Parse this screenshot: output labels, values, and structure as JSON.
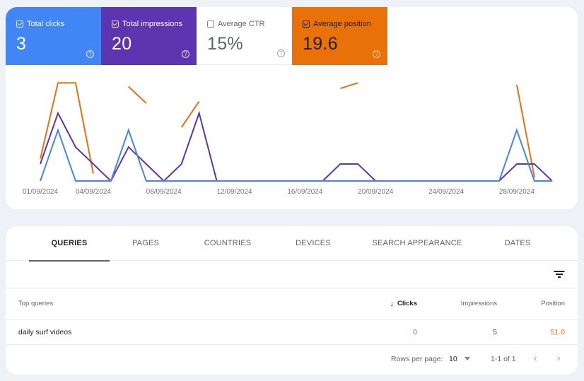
{
  "metrics": [
    {
      "key": "clicks",
      "label": "Total clicks",
      "value": "3",
      "checked": true,
      "color": "#4285f4"
    },
    {
      "key": "impressions",
      "label": "Total impressions",
      "value": "20",
      "checked": true,
      "color": "#5e35b1"
    },
    {
      "key": "ctr",
      "label": "Average CTR",
      "value": "15%",
      "checked": false,
      "color": "#00897b"
    },
    {
      "key": "position",
      "label": "Average position",
      "value": "19.6",
      "checked": true,
      "color": "#e8710a"
    }
  ],
  "help_glyph": "?",
  "chart_data": {
    "type": "line",
    "title": "",
    "xlabel": "",
    "ylabel": "",
    "x": [
      "01/09/2024",
      "02/09/2024",
      "03/09/2024",
      "04/09/2024",
      "05/09/2024",
      "06/09/2024",
      "07/09/2024",
      "08/09/2024",
      "09/09/2024",
      "10/09/2024",
      "11/09/2024",
      "12/09/2024",
      "13/09/2024",
      "14/09/2024",
      "15/09/2024",
      "16/09/2024",
      "17/09/2024",
      "18/09/2024",
      "19/09/2024",
      "20/09/2024",
      "21/09/2024",
      "22/09/2024",
      "23/09/2024",
      "24/09/2024",
      "25/09/2024",
      "26/09/2024",
      "27/09/2024",
      "28/09/2024",
      "29/09/2024",
      "30/09/2024"
    ],
    "x_tick_labels": [
      "01/09/2024",
      "04/09/2024",
      "08/09/2024",
      "12/09/2024",
      "16/09/2024",
      "20/09/2024",
      "24/09/2024",
      "28/09/2024"
    ],
    "x_tick_indices": [
      0,
      3,
      7,
      11,
      15,
      19,
      23,
      27
    ],
    "grid": false,
    "series": [
      {
        "name": "Clicks",
        "color": "#4285f4",
        "ylim": [
          0,
          2
        ],
        "values": [
          0,
          1,
          0,
          0,
          0,
          1,
          0,
          0,
          0,
          0,
          0,
          0,
          0,
          0,
          0,
          0,
          0,
          0,
          0,
          0,
          0,
          0,
          0,
          0,
          0,
          0,
          0,
          1,
          0,
          0
        ]
      },
      {
        "name": "Impressions",
        "color": "#5e35b1",
        "ylim": [
          0,
          6
        ],
        "values": [
          1,
          4,
          2,
          1,
          0,
          2,
          1,
          0,
          1,
          4,
          0,
          0,
          0,
          0,
          0,
          0,
          0,
          1,
          1,
          0,
          0,
          0,
          0,
          0,
          0,
          0,
          0,
          1,
          1,
          0
        ]
      },
      {
        "name": "Position",
        "color": "#e8710a",
        "ylim": [
          0,
          55
        ],
        "inverted": true,
        "values": [
          43,
          2,
          2,
          51,
          null,
          4,
          13,
          null,
          26,
          12,
          null,
          null,
          null,
          null,
          null,
          null,
          null,
          5,
          2,
          null,
          null,
          null,
          null,
          null,
          null,
          null,
          null,
          3,
          53,
          null
        ]
      }
    ]
  },
  "tabs": [
    {
      "label": "QUERIES",
      "active": true
    },
    {
      "label": "PAGES",
      "active": false
    },
    {
      "label": "COUNTRIES",
      "active": false
    },
    {
      "label": "DEVICES",
      "active": false
    },
    {
      "label": "SEARCH APPEARANCE",
      "active": false
    },
    {
      "label": "DATES",
      "active": false
    }
  ],
  "table": {
    "columns": {
      "query": "Top queries",
      "clicks": "Clicks",
      "impressions": "Impressions",
      "position": "Position"
    },
    "sort_icon": "↓",
    "rows": [
      {
        "query": "daily surf videos",
        "clicks": "0",
        "impressions": "5",
        "position": "51.0"
      }
    ]
  },
  "pagination": {
    "rows_per_page_label": "Rows per page:",
    "rows_per_page": "10",
    "range": "1-1 of 1",
    "prev_glyph": "‹",
    "next_glyph": "›"
  }
}
